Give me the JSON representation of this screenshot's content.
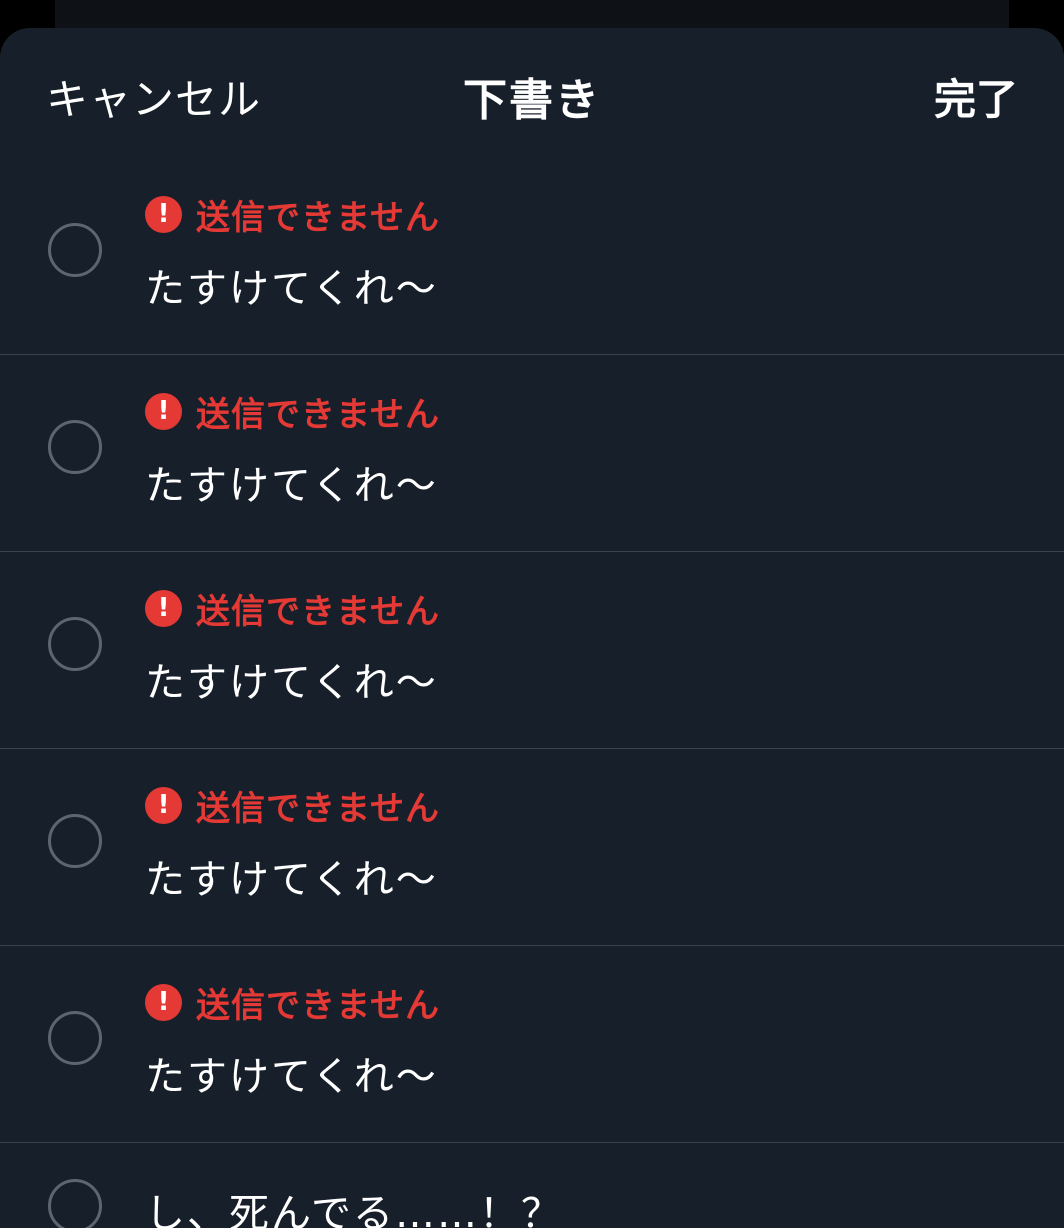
{
  "header": {
    "cancel_label": "キャンセル",
    "title": "下書き",
    "done_label": "完了"
  },
  "drafts": [
    {
      "status": "送信できません",
      "text": "たすけてくれ〜"
    },
    {
      "status": "送信できません",
      "text": "たすけてくれ〜"
    },
    {
      "status": "送信できません",
      "text": "たすけてくれ〜"
    },
    {
      "status": "送信できません",
      "text": "たすけてくれ〜"
    },
    {
      "status": "送信できません",
      "text": "たすけてくれ〜"
    }
  ],
  "partial_draft": {
    "text": "し、死んでる……！？"
  },
  "icons": {
    "alert": "exclamation-circle-icon",
    "alert_glyph": "!"
  },
  "colors": {
    "background": "#17202a",
    "error": "#e53935",
    "divider": "#38444d"
  }
}
